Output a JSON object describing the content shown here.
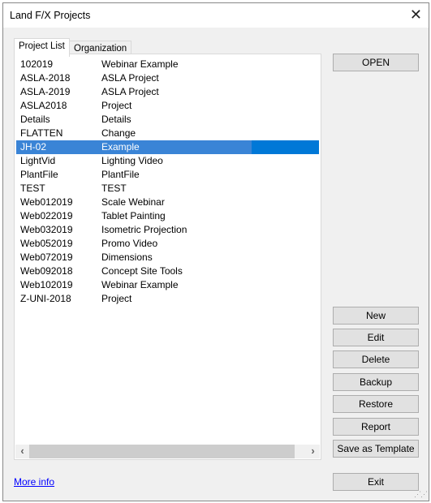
{
  "window": {
    "title": "Land F/X Projects",
    "close_label": "✕"
  },
  "tabs": [
    {
      "label": "Project List",
      "active": true
    },
    {
      "label": "Organization",
      "active": false
    }
  ],
  "projects": [
    {
      "name": "102019",
      "description": "Webinar Example"
    },
    {
      "name": "ASLA-2018",
      "description": "ASLA Project"
    },
    {
      "name": "ASLA-2019",
      "description": "ASLA Project"
    },
    {
      "name": "ASLA2018",
      "description": "Project"
    },
    {
      "name": "Details",
      "description": "Details"
    },
    {
      "name": "FLATTEN",
      "description": "Change"
    },
    {
      "name": "JH-02",
      "description": "Example",
      "selected": true
    },
    {
      "name": "LightVid",
      "description": "Lighting Video"
    },
    {
      "name": "PlantFile",
      "description": "PlantFile"
    },
    {
      "name": "TEST",
      "description": "TEST"
    },
    {
      "name": "Web012019",
      "description": "Scale Webinar"
    },
    {
      "name": "Web022019",
      "description": "Tablet Painting"
    },
    {
      "name": "Web032019",
      "description": "Isometric Projection"
    },
    {
      "name": "Web052019",
      "description": "Promo Video"
    },
    {
      "name": "Web072019",
      "description": "Dimensions"
    },
    {
      "name": "Web092018",
      "description": "Concept Site Tools"
    },
    {
      "name": "Web102019",
      "description": "Webinar Example"
    },
    {
      "name": "Z-UNI-2018",
      "description": "Project"
    }
  ],
  "buttons": {
    "open": "OPEN",
    "new": "New",
    "edit": "Edit",
    "delete": "Delete",
    "backup": "Backup",
    "restore": "Restore",
    "report": "Report",
    "save_template": "Save as Template",
    "exit": "Exit"
  },
  "scroll": {
    "left": "‹",
    "right": "›"
  },
  "more_info": "More info",
  "colors": {
    "selection": "#0078d7",
    "link": "#0000ff"
  }
}
